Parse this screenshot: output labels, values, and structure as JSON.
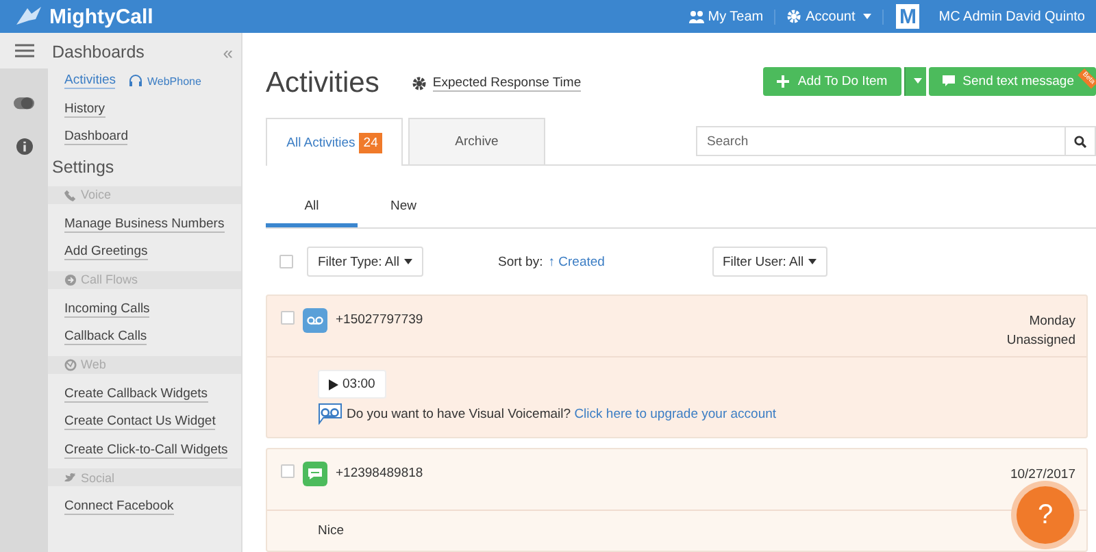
{
  "topbar": {
    "logo": "MightyCall",
    "links": [
      {
        "kind": "team",
        "label": "My Team"
      },
      {
        "kind": "account",
        "label": "Account"
      }
    ],
    "avatar": "M",
    "user": "MC Admin David Quinto"
  },
  "sidebar": {
    "title": "Dashboards",
    "collapse": "«",
    "dashboard_items": [
      {
        "label": "Activities",
        "selected": true,
        "extra": "WebPhone"
      },
      {
        "label": "History",
        "selected": false
      },
      {
        "label": "Dashboard",
        "selected": false
      }
    ],
    "settings_title": "Settings",
    "groups": [
      {
        "kind": "voice",
        "label": "Voice",
        "items": [
          "Manage Business Numbers",
          "Add Greetings"
        ]
      },
      {
        "kind": "flows",
        "label": "Call Flows",
        "items": [
          "Incoming Calls",
          "Callback Calls"
        ]
      },
      {
        "kind": "web",
        "label": "Web",
        "items": [
          "Create Callback Widgets",
          "Create Contact Us Widget",
          "Create Click-to-Call Widgets"
        ]
      },
      {
        "kind": "social",
        "label": "Social",
        "items": [
          "Connect Facebook"
        ]
      }
    ]
  },
  "page": {
    "title": "Activities",
    "response_link": "Expected Response Time",
    "add_button": "Add To Do Item",
    "send_button": "Send text message",
    "ribbon": "Beta"
  },
  "tabs": [
    {
      "label": "All Activities",
      "count": "24",
      "selected": true
    },
    {
      "label": "Archive",
      "selected": false
    }
  ],
  "search": {
    "placeholder": "Search"
  },
  "subtabs": [
    {
      "label": "All",
      "selected": true
    },
    {
      "label": "New",
      "selected": false
    }
  ],
  "filters": {
    "select_all_checked": false,
    "type": "Filter Type: All",
    "sort_label": "Sort by:",
    "sort_arrow": "↑",
    "sort_value": "Created",
    "user": "Filter User: All"
  },
  "activities": [
    {
      "kind": "voicemail",
      "phone": "+15027797739",
      "date": "Monday",
      "assignee": "Unassigned",
      "duration": "03:00",
      "prompt": "Do you want to have Visual Voicemail?",
      "link": "Click here to upgrade your account",
      "checked": false
    },
    {
      "kind": "sms",
      "phone": "+12398489818",
      "date": "10/27/2017",
      "message": "Nice",
      "checked": false
    }
  ],
  "help": "?"
}
